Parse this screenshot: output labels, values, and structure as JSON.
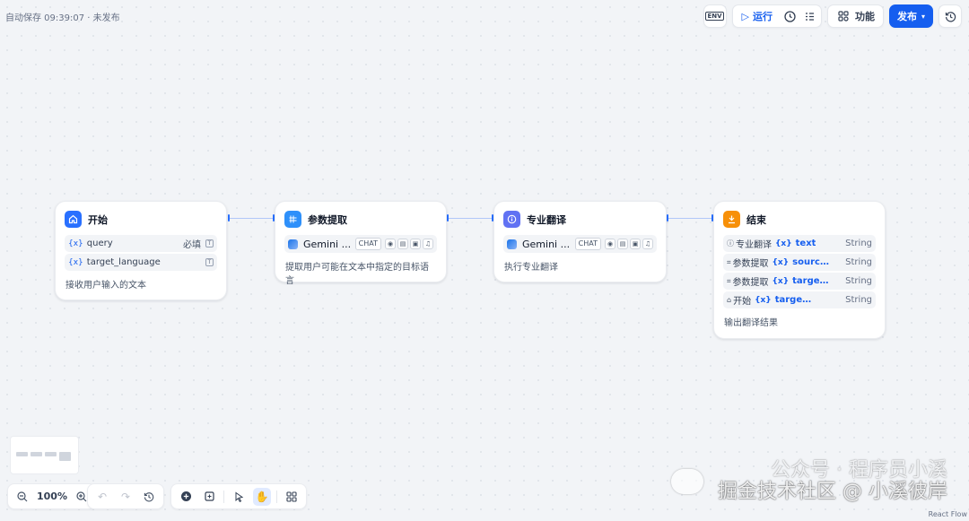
{
  "status": {
    "saved": "自动保存 09:39:07 · 未发布"
  },
  "toolbar": {
    "env_label": "ENV",
    "run_label": "运行",
    "features_label": "功能",
    "publish_label": "发布"
  },
  "nodes": {
    "start": {
      "title": "开始",
      "variables": [
        {
          "var_icon": "{x}",
          "name": "query",
          "required": "必填"
        },
        {
          "var_icon": "{x}",
          "name": "target_language",
          "required": ""
        }
      ],
      "description": "接收用户输入的文本"
    },
    "param_extract": {
      "title": "参数提取",
      "model": "Gemini ...",
      "model_mode": "CHAT",
      "description": "提取用户可能在文本中指定的目标语言"
    },
    "translate": {
      "title": "专业翻译",
      "model": "Gemini ...",
      "model_mode": "CHAT",
      "description": "执行专业翻译"
    },
    "end": {
      "title": "结束",
      "outputs": [
        {
          "source": "专业翻译",
          "source_icon": "info-icon",
          "var_icon": "{x}",
          "var": "text",
          "type": "String"
        },
        {
          "source": "参数提取",
          "source_icon": "param-icon",
          "var_icon": "{x}",
          "var": "source...",
          "type": "String"
        },
        {
          "source": "参数提取",
          "source_icon": "param-icon",
          "var_icon": "{x}",
          "var": "target...",
          "type": "String"
        },
        {
          "source": "开始",
          "source_icon": "home-icon",
          "var_icon": "{x}",
          "var": "target...",
          "type": "String"
        }
      ],
      "description": "输出翻译结果"
    }
  },
  "zoom": {
    "level": "100%"
  },
  "watermark": {
    "line1": "公众号 · 程序员小溪",
    "line2": "掘金技术社区 @ 小溪彼岸"
  },
  "attribution": "React Flow",
  "colors": {
    "accent": "#155eef",
    "start_icon": "#2970ff",
    "param_icon": "#2e90fa",
    "translate_icon": "#6172f3",
    "end_icon": "#f79009"
  }
}
